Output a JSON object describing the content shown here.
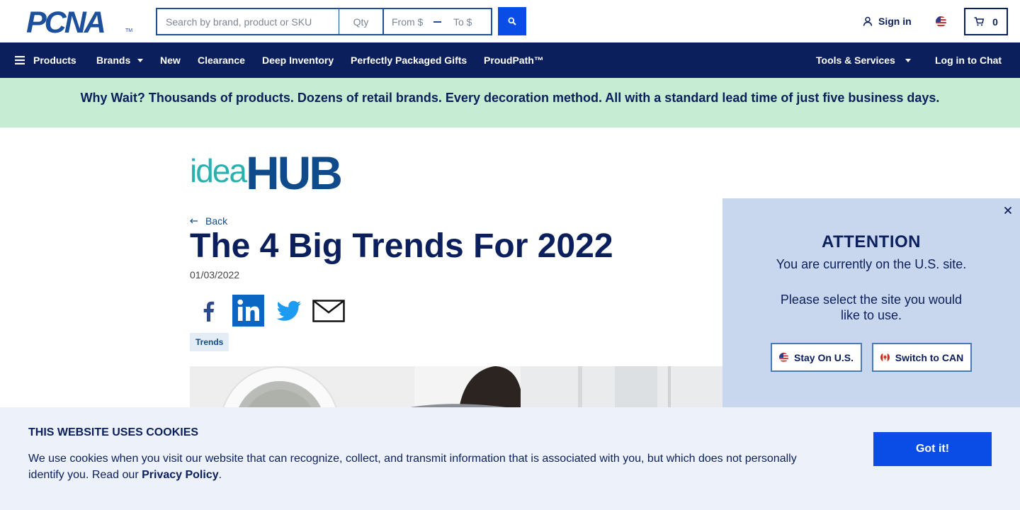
{
  "header": {
    "logo": "PCNA",
    "logo_tm": "TM",
    "search": {
      "placeholder": "Search by brand, product or SKU",
      "value": ""
    },
    "qty": {
      "placeholder": "Qty",
      "value": ""
    },
    "price_from": {
      "placeholder": "From $",
      "value": ""
    },
    "price_to": {
      "placeholder": "To $",
      "value": ""
    },
    "signin_label": "Sign in",
    "cart_count": "0",
    "search_icon": "search-icon",
    "user_icon": "user-icon",
    "flag_icon": "us-flag-icon",
    "cart_icon": "cart-icon"
  },
  "nav": {
    "products": "Products",
    "brands": "Brands",
    "new": "New",
    "clearance": "Clearance",
    "deep_inventory": "Deep Inventory",
    "gifts": "Perfectly Packaged Gifts",
    "proudpath": "ProudPath™",
    "tools": "Tools & Services",
    "chat": "Log in to Chat"
  },
  "banner": {
    "text": "Why Wait? Thousands of products. Dozens of retail brands. Every decoration method. All with a standard lead time of just five business days."
  },
  "article": {
    "brand_idea": "idea",
    "brand_hub": "HUB",
    "back_label": "Back",
    "title": "The 4 Big Trends For 2022",
    "date": "01/03/2022",
    "tag": "Trends",
    "share_icons": [
      "facebook-icon",
      "linkedin-icon",
      "twitter-icon",
      "email-icon"
    ]
  },
  "attention": {
    "title": "ATTENTION",
    "line1": "You are currently on the U.S. site.",
    "line2": "Please select the site you would like to use.",
    "stay_label": "Stay On U.S.",
    "switch_label": "Switch to CAN"
  },
  "cookies": {
    "title": "THIS WEBSITE USES COOKIES",
    "text": "We use cookies when you visit our website that can recognize, collect, and transmit information that is associated with you, but which does not personally identify you. Read our ",
    "link": "Privacy Policy",
    "period": ".",
    "button": "Got it!"
  },
  "colors": {
    "navy": "#0a1f5c",
    "accent_blue": "#0a4de6",
    "banner_green": "#c6edd4",
    "popup_bg": "#c9d7ee",
    "cookie_bg": "#edf1fa"
  }
}
